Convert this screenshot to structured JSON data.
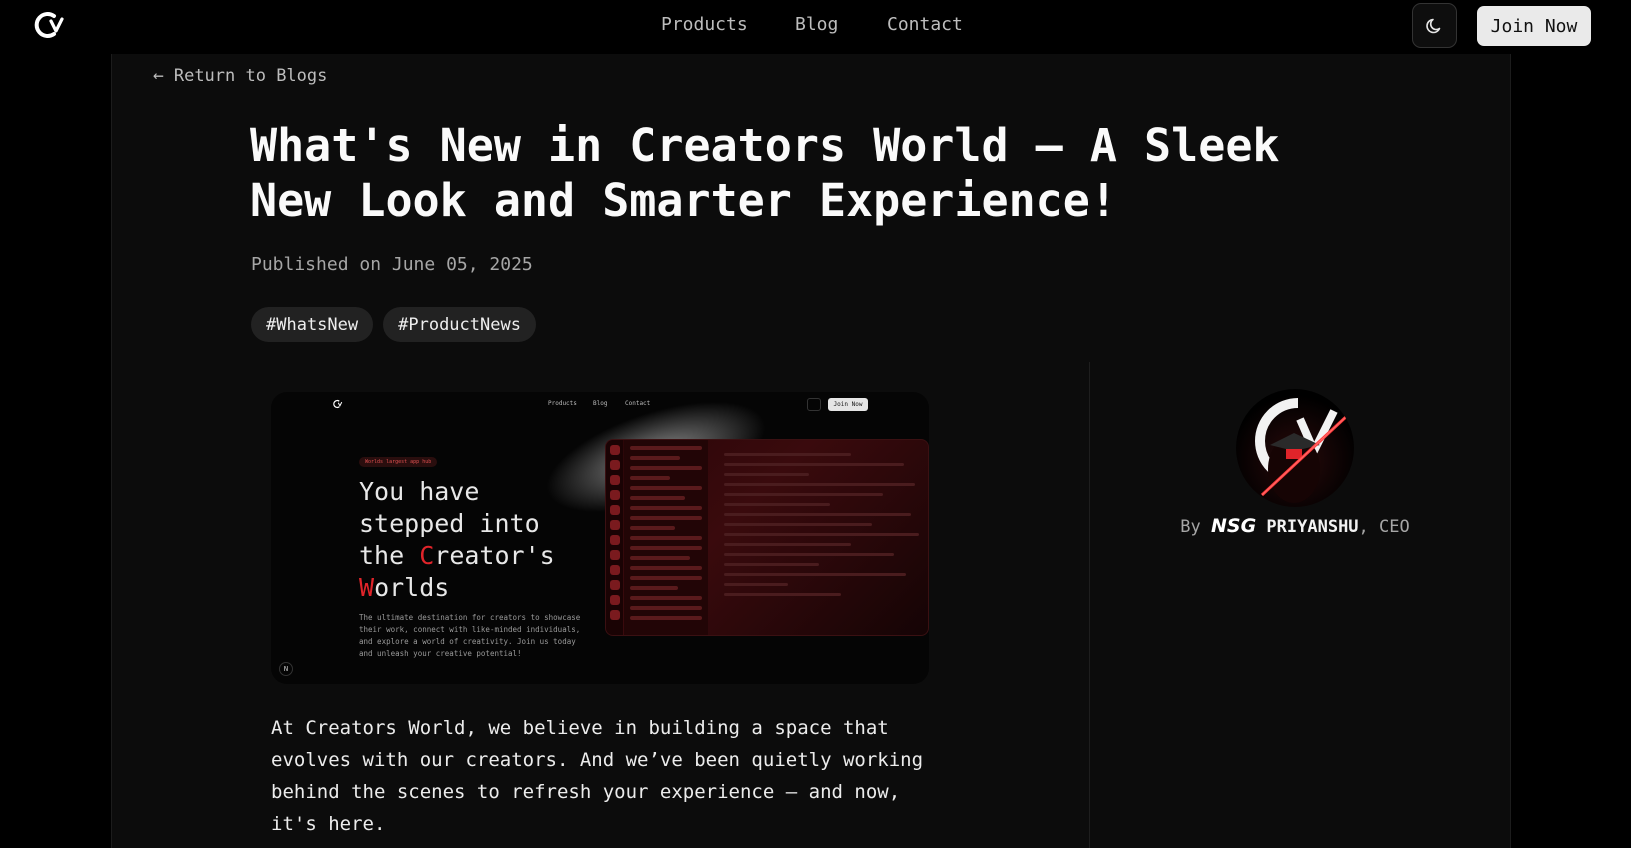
{
  "header": {
    "nav": [
      "Products",
      "Blog",
      "Contact"
    ],
    "join_label": "Join Now"
  },
  "back_link": "Return to Blogs",
  "post": {
    "title": "What's New in Creators World — A Sleek New Look and Smarter Experience!",
    "published": "Published on June 05, 2025",
    "tags": [
      "#WhatsNew",
      "#ProductNews"
    ],
    "body": "At Creators World, we believe in building a space that evolves with our creators. And we’ve been quietly working behind the scenes to refresh your experience — and now, it's here."
  },
  "hero": {
    "nav": [
      "Products",
      "Blog",
      "Contact"
    ],
    "join_label": "Join Now",
    "badge": "Worlds largest app hub",
    "headline": [
      "You have",
      "stepped into",
      "the ",
      "C",
      "reator's",
      "W",
      "orlds"
    ],
    "subtext": "The ultimate destination for creators to showcase their work, connect with like-minded individuals, and explore a world of creativity. Join us today and unleash your creative potential!",
    "corner_glyph": "N"
  },
  "author": {
    "prefix": "By",
    "mark": "NSG",
    "name": "PRIYANSHU",
    "role": ", CEO"
  },
  "colors": {
    "background": "#000000",
    "panel": "#0c0c0c",
    "accent_red": "#e0242a",
    "join_button": "#eaeaea"
  }
}
